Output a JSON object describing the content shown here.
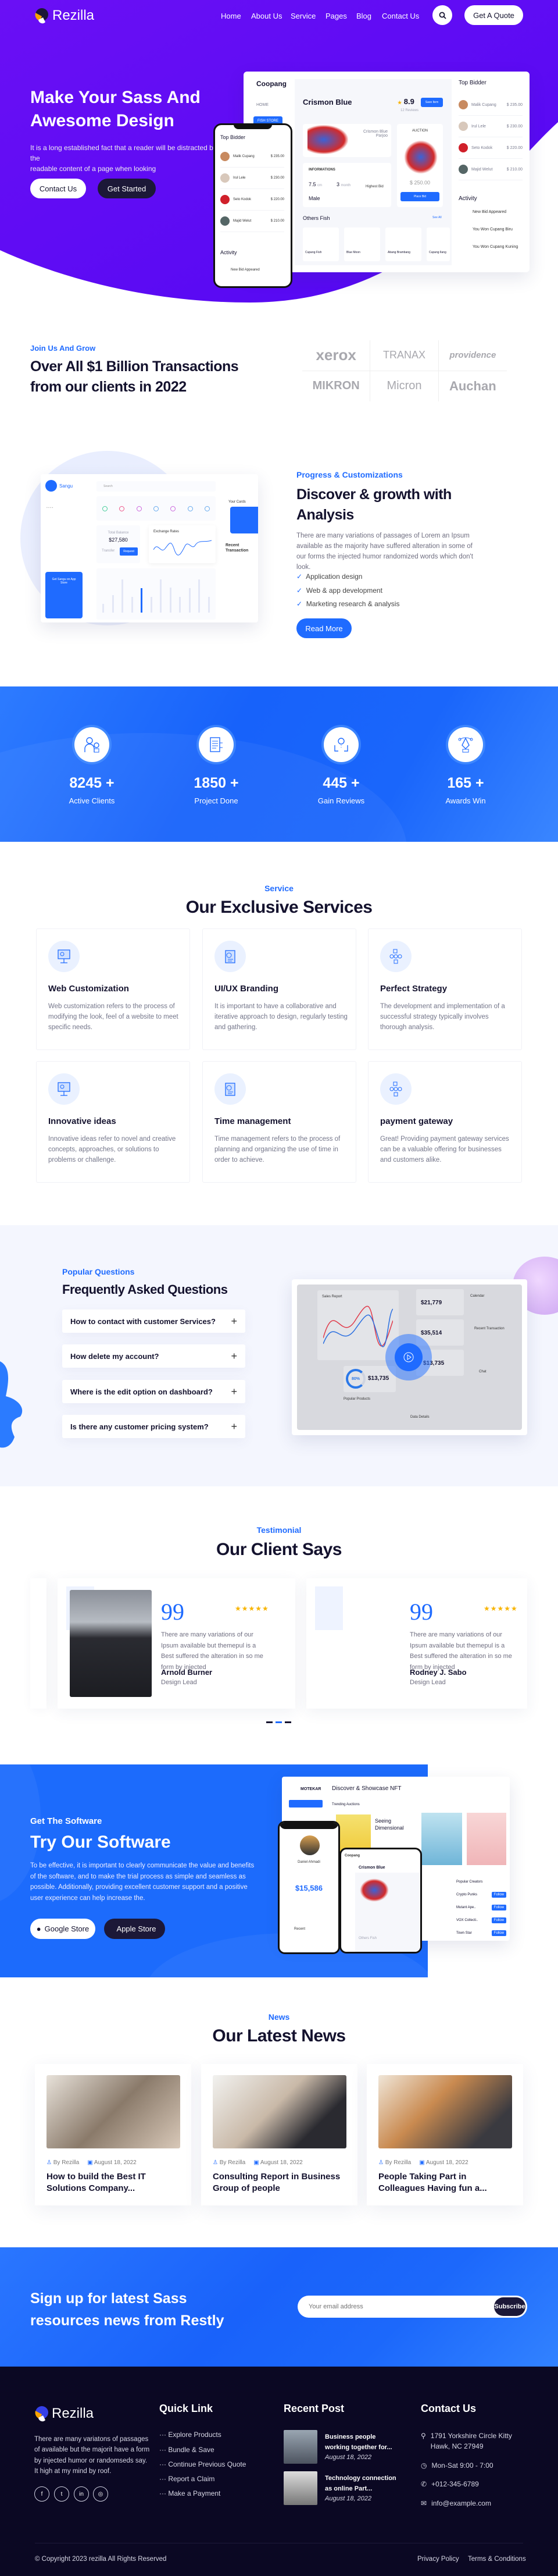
{
  "colors": {
    "purple": "#5e0df5",
    "blue": "#1f6bff",
    "dark": "#0b0823",
    "navy": "#1c1838",
    "star": "#f8b400"
  },
  "nav": {
    "logo": "Rezilla",
    "items": [
      "Home",
      "About Us",
      "Service",
      "Pages",
      "Blog",
      "Contact Us"
    ],
    "search_icon": "search-icon",
    "quote": "Get A Quote"
  },
  "hero": {
    "title_1": "Make Your Sass And",
    "title_2": "Awesome Design",
    "text_1": "It is a long established fact that a reader will be distracted by the",
    "text_2": "readable content of a page when looking",
    "contact": "Contact Us",
    "started": "Get Started",
    "mock": {
      "brand": "Coopang",
      "menu_home": "HOME",
      "menu_store": "FISH STORE",
      "fish": "Crismon Blue",
      "rating": "8.9",
      "save": "Save Item",
      "reviews": "12 Reviews",
      "fish_card": "Crismon Blue Parjoo",
      "info": "INFORMATIONS",
      "length": "7.5",
      "length_unit": "cm",
      "age": "3",
      "age_unit": "month",
      "gender": "Male",
      "highest_bid": "Highest Bid",
      "auction": "AUCTION",
      "price": "$ 250.00",
      "place_bid": "Place Bid",
      "others": "Others Fish",
      "see_all": "See All",
      "others_list": [
        "Cupang Fish",
        "Blue Moon",
        "Abang Brambang",
        "Cupang Ilang"
      ],
      "top_bidder": "Top Bidder",
      "bidders": [
        {
          "name": "Malik Cupang",
          "amount": "$ 235.00"
        },
        {
          "name": "Irul Lele",
          "amount": "$ 230.00"
        },
        {
          "name": "Seto Kodok",
          "amount": "$ 220.00"
        },
        {
          "name": "Majid Welut",
          "amount": "$ 210.00"
        }
      ],
      "activity": "Activity",
      "activities": [
        "New Bid Appeared",
        "You Won Cupang Biru",
        "You Won Cupang Kuning"
      ]
    }
  },
  "partners": {
    "tag": "Join Us And Grow",
    "title_1": "Over All $1 Billion Transactions",
    "title_2": "from our clients in 2022",
    "logos": [
      "xerox",
      "TRANAX",
      "providence",
      "MIKRON",
      "Micron",
      "Auchan"
    ]
  },
  "discover": {
    "tag": "Progress & Customizations",
    "title_1": "Discover & growth with",
    "title_2": "Analysis",
    "text": "There are many variations of passages of Lorem an Ipsum available as the majority have suffered alteration in some of our forms the injected humor randomized words which don't look.",
    "checks": [
      "Application design",
      "Web & app development",
      "Marketing research & analysis"
    ],
    "button": "Read More",
    "mock": {
      "brand": "Sangu",
      "search": "Search",
      "balance_label": "Total Balance",
      "balance": "$27,580",
      "exchange": "Exchange Rates",
      "cards": "Your Cards",
      "recent": "Recent Transaction",
      "transfer": "Transfer",
      "request": "Request",
      "promo": "Get Sangu on App Store"
    }
  },
  "stats": [
    {
      "value": "8245 +",
      "label": "Active Clients",
      "icon": "client-icon"
    },
    {
      "value": "1850 +",
      "label": "Project Done",
      "icon": "document-icon"
    },
    {
      "value": "445 +",
      "label": "Gain Reviews",
      "icon": "idea-hands-icon"
    },
    {
      "value": "165 +",
      "label": "Awards Win",
      "icon": "pen-tool-icon"
    }
  ],
  "services": {
    "tag": "Service",
    "title": "Our Exclusive Services",
    "items": [
      {
        "title": "Web Customization",
        "text": "Web customization refers to the process of modifying the look, feel of a website to meet specific needs.",
        "icon": "monitor-icon"
      },
      {
        "title": "UI/UX Branding",
        "text": "It is important to have a collaborative and iterative approach to design, regularly testing and gathering.",
        "icon": "clipboard-icon"
      },
      {
        "title": "Perfect Strategy",
        "text": "The development and implementation of a successful strategy typically involves thorough analysis.",
        "icon": "flowchart-icon"
      },
      {
        "title": "Innovative ideas",
        "text": "Innovative ideas refer to novel and creative concepts, approaches, or solutions to problems or challenge.",
        "icon": "monitor-icon"
      },
      {
        "title": "Time management",
        "text": "Time management refers to the process of planning and organizing the use of time in order to achieve.",
        "icon": "clipboard-icon"
      },
      {
        "title": "payment gateway",
        "text": "Great! Providing payment gateway services can be a valuable offering for businesses and customers alike.",
        "icon": "flowchart-icon"
      }
    ]
  },
  "faq": {
    "tag": "Popular Questions",
    "title": "Frequently Asked Questions",
    "items": [
      "How to contact with customer Services?",
      "How delete my account?",
      "Where is the edit option on dashboard?",
      "Is there any customer pricing system?"
    ],
    "mock": {
      "report": "Sales Report",
      "v1": "$21,779",
      "v2": "$35,514",
      "v3": "$13,735",
      "v4": "$13,735",
      "pct": "80%",
      "calendar": "Calendar",
      "recent": "Recent Transaction",
      "chat": "Chat",
      "popular": "Popular Products",
      "data": "Data Details"
    }
  },
  "testimonials": {
    "tag": "Testimonial",
    "title": "Our Client Says",
    "rating": 5,
    "items": [
      {
        "text": "There are many variations of our Ipsum available but themepul is a Best suffered the alteration in so me form by injected",
        "name": "Arnold Burner",
        "role": "Design Lead"
      },
      {
        "text": "There are many variations of our Ipsum available but themepul is a Best suffered the alteration in so me form by injected",
        "name": "Rodney J. Sabo",
        "role": "Design Lead"
      }
    ],
    "active_dot": 1
  },
  "app": {
    "tag": "Get The Software",
    "title": "Try Our Software",
    "text": "To be effective, it is important to clearly communicate the value and benefits of the software, and to make the trial process as simple and seamless as possible. Additionally, providing excellent customer support and a positive user experience can help increase the.",
    "google": "Google Store",
    "apple": "Apple Store",
    "mock": {
      "brand": "MOTEKAR",
      "title": "Discover & Showcase NFT",
      "trending": "Trending Auctions",
      "art": "Seeing Dimensional",
      "creators": "Popular Creators",
      "creator_list": [
        "Crypto Punks",
        "Mutant Ape..",
        "VOX Collecti..",
        "Town Star"
      ],
      "follow": "Follow",
      "phone_name": "Daniel Ahmadi",
      "phone_balance": "$15,586",
      "recent": "Recent",
      "phone2_brand": "Coopang",
      "phone2_fish": "Crismon Blue",
      "phone2_others": "Others Fish",
      "length": "7.5",
      "age": "3",
      "gender": "Male"
    }
  },
  "news": {
    "tag": "News",
    "title": "Our Latest News",
    "items": [
      {
        "author": "By Rezilla",
        "date": "August 18, 2022",
        "title": "How to build the Best IT Solutions Company..."
      },
      {
        "author": "By Rezilla",
        "date": "August 18, 2022",
        "title": "Consulting Report in Business Group of people"
      },
      {
        "author": "By Rezilla",
        "date": "August 18, 2022",
        "title": "People Taking Part in Colleagues Having fun a..."
      }
    ]
  },
  "newsletter": {
    "title_1": "Sign up for latest Sass",
    "title_2": "resources news from Restly",
    "placeholder": "Your email address",
    "button": "Subscribe"
  },
  "footer": {
    "logo": "Rezilla",
    "about": "There are many variatons of passages of available but the majorit have a form by injected humor or randomseds say. It high at my mind by roof.",
    "social": [
      "facebook-icon",
      "twitter-icon",
      "linkedin-icon",
      "instagram-icon"
    ],
    "quick_title": "Quick Link",
    "quick": [
      "Explore Products",
      "Bundle & Save",
      "Continue Previous Quote",
      "Report a Claim",
      "Make a Payment"
    ],
    "recent_title": "Recent Post",
    "posts": [
      {
        "title": "Business people working together for...",
        "date": "August 18, 2022"
      },
      {
        "title": "Technology connection as online Part...",
        "date": "August 18, 2022"
      }
    ],
    "contact_title": "Contact Us",
    "address": "1791 Yorkshire Circle Kitty Hawk, NC 27949",
    "hours": "Mon-Sat 9:00 - 7:00",
    "phone": "+012-345-6789",
    "email": "info@example.com",
    "copyright": "© Copyright 2023 rezilla All Rights Reserved",
    "privacy": "Privacy Policy",
    "terms": "Terms & Conditions"
  }
}
